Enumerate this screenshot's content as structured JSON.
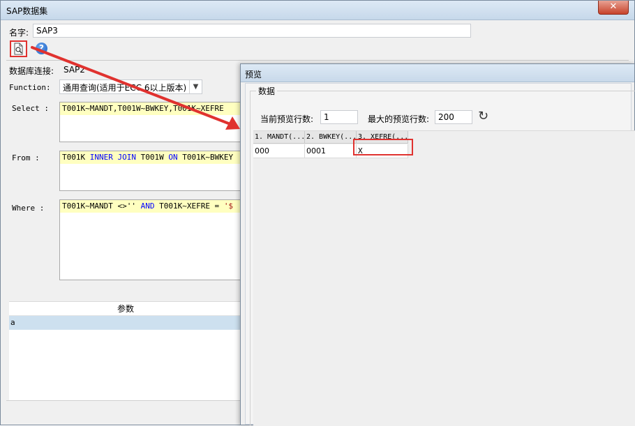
{
  "main_window": {
    "title": "SAP数据集",
    "close_label": "✕",
    "name_label": "名字:",
    "name_value": "SAP3",
    "db_label": "数据库连接:",
    "db_value": "SAP2",
    "function_label": "Function:",
    "function_value": "通用查询(适用于ECC 6以上版本)",
    "select_label": "Select :",
    "from_label": "From :",
    "where_label": "Where :",
    "select_sql": "T001K~MANDT,T001W~BWKEY,T001K~XEFRE",
    "from_sql": {
      "a": "T001K ",
      "kw1": "INNER JOIN",
      "b": " T001W ",
      "kw2": "ON",
      "c": " T001K~BWKEY"
    },
    "where_sql": {
      "a": "T001K~MANDT <>'' ",
      "kw1": "AND",
      "b": " T001K~XEFRE = ",
      "str": "'$"
    },
    "params_header": "参数",
    "params_row": "a"
  },
  "preview_dialog": {
    "title": "预览",
    "group_label": "数据",
    "current_rows_label": "当前预览行数:",
    "current_rows_value": "1",
    "max_rows_label": "最大的预览行数:",
    "max_rows_value": "200",
    "columns": [
      "1. MANDT(...",
      "2. BWKEY(...",
      "3. XEFRE(..."
    ],
    "row": [
      "000",
      "0001",
      "X"
    ]
  },
  "icons": {
    "preview": "preview-icon",
    "help": "help-icon",
    "refresh": "refresh-icon"
  },
  "colors": {
    "highlight": "#e0322f",
    "sql_line_bg": "#ffffc0",
    "keyword": "#0000ff"
  }
}
